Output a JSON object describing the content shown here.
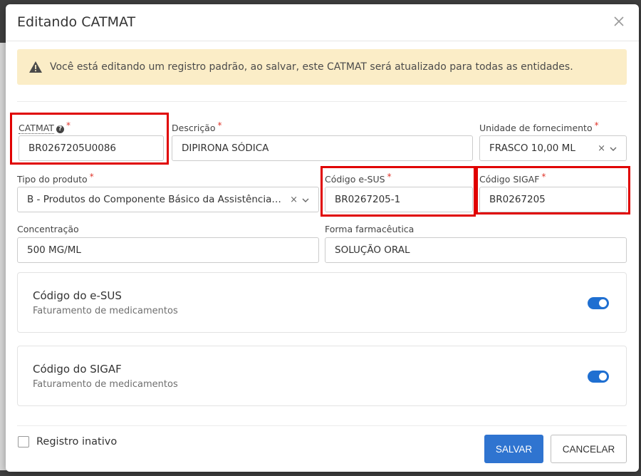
{
  "modal": {
    "title": "Editando CATMAT",
    "close_icon": "close-icon",
    "alert": "Você está editando um registro padrão, ao salvar, este CATMAT será atualizado para todas as entidades.",
    "alert_icon": "warning-triangle-icon"
  },
  "fields": {
    "catmat": {
      "label": "CATMAT",
      "required": "*",
      "value": "BR0267205U0086",
      "help_icon": "question-circle-icon"
    },
    "descricao": {
      "label": "Descrição",
      "required": "*",
      "value": "DIPIRONA SÓDICA"
    },
    "unidade": {
      "label": "Unidade de fornecimento",
      "required": "*",
      "value": "FRASCO 10,00 ML"
    },
    "tipo": {
      "label": "Tipo do produto",
      "required": "*",
      "value": "B - Produtos do Componente Básico da Assistência Farmacêutica"
    },
    "esus": {
      "label": "Código e-SUS",
      "required": "*",
      "value": "BR0267205-1"
    },
    "sigaf": {
      "label": "Código SIGAF",
      "required": "*",
      "value": "BR0267205"
    },
    "concentracao": {
      "label": "Concentração",
      "value": "500 MG/ML"
    },
    "forma": {
      "label": "Forma farmacêutica",
      "value": "SOLUÇÃO ORAL"
    }
  },
  "toggles": [
    {
      "title": "Código do e-SUS",
      "subtitle": "Faturamento de medicamentos",
      "on": true
    },
    {
      "title": "Código do SIGAF",
      "subtitle": "Faturamento de medicamentos",
      "on": true
    }
  ],
  "footer": {
    "inactive_label": "Registro inativo",
    "save_label": "SALVAR",
    "cancel_label": "CANCELAR"
  },
  "select_clear": "×",
  "colors": {
    "primary": "#2f74d0",
    "alert_bg": "#fbedc7",
    "required": "#e0352b",
    "highlight": "#e00000"
  }
}
